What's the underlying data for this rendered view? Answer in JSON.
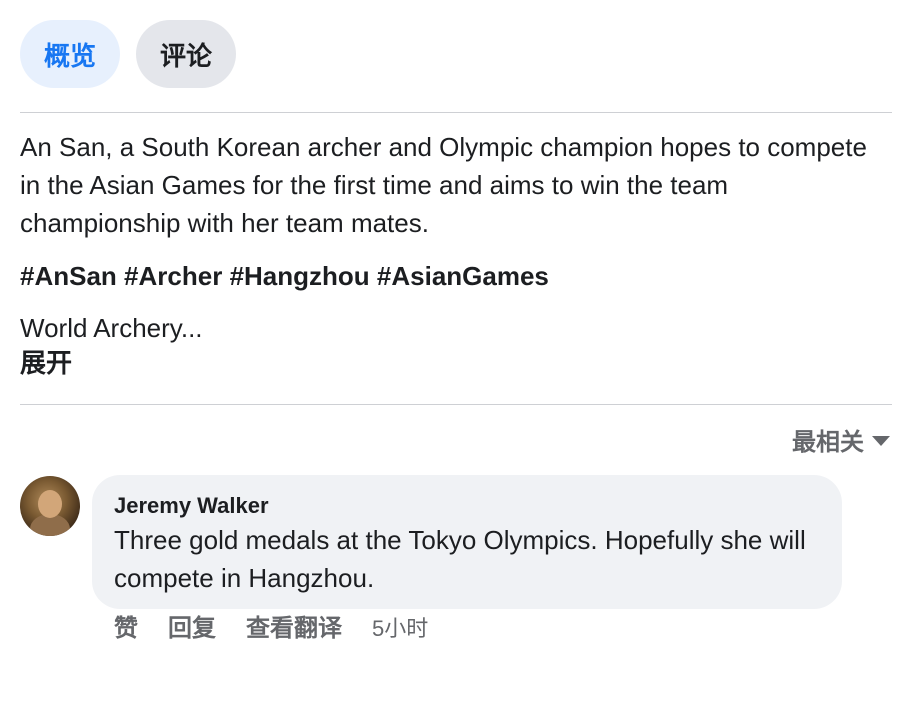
{
  "tabs": [
    {
      "label": "概览",
      "active": true
    },
    {
      "label": "评论",
      "active": false
    }
  ],
  "post": {
    "description": "An San, a South Korean archer and Olympic champion hopes to compete in the Asian Games for the first time and aims to win the team championship with her team mates.",
    "hashtags": [
      "#AnSan",
      "#Archer",
      "#Hangzhou",
      "#AsianGames"
    ],
    "truncated_text": "World Archery...",
    "expand_label": "展开"
  },
  "comments_sort": {
    "label": "最相关",
    "icon": "caret-down-icon"
  },
  "comment": {
    "author": "Jeremy Walker",
    "text": "Three gold medals at the Tokyo Olympics. Hopefully she will compete in Hangzhou.",
    "actions": {
      "like": "赞",
      "reply": "回复",
      "translate": "查看翻译",
      "time": "5小时"
    }
  },
  "colors": {
    "accent": "#1877f2",
    "active_tab_bg": "#e7f0fd",
    "inactive_tab_bg": "#e4e6eb",
    "bubble_bg": "#f0f2f5",
    "secondary_text": "#65676b"
  }
}
